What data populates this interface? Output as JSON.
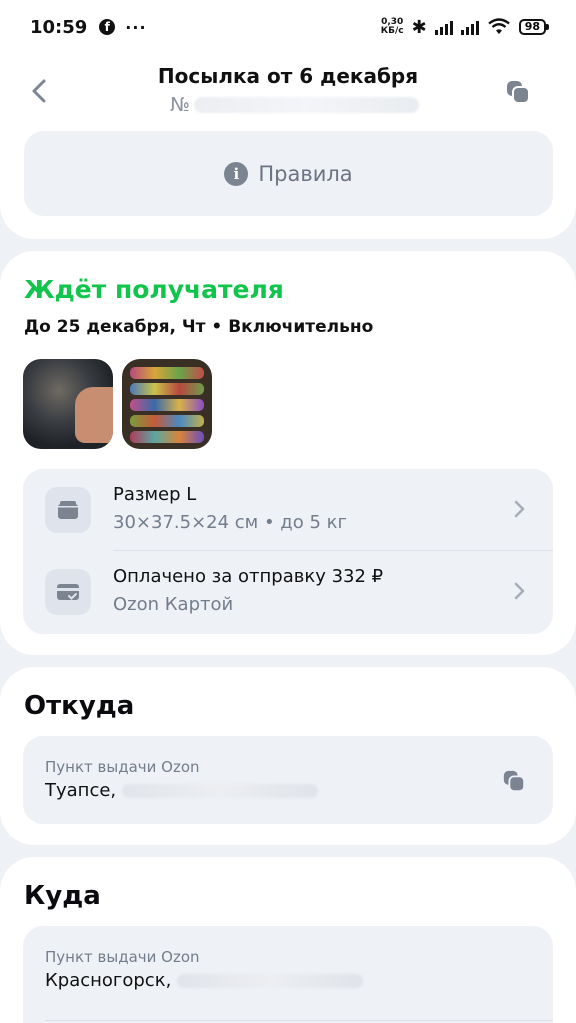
{
  "status_bar": {
    "time": "10:59",
    "social_icon": "facebook-icon",
    "more": "···",
    "net_speed_value": "0,30",
    "net_speed_unit": "КБ/с",
    "battery": "98"
  },
  "header": {
    "title": "Посылка от 6 декабря",
    "number_prefix": "№",
    "back_icon": "chevron-left-icon",
    "copy_icon": "copy-icon"
  },
  "rules": {
    "label": "Правила",
    "icon": "info-icon"
  },
  "status": {
    "title": "Ждёт получателя",
    "deadline": "До 25 декабря, Чт • Включительно",
    "accent_color": "#10c44c"
  },
  "details": [
    {
      "title": "Размер L",
      "subtitle": "30×37.5×24 см • до 5 кг",
      "icon": "box-icon"
    },
    {
      "title": "Оплачено за отправку 332 ₽",
      "subtitle": "Ozon Картой",
      "icon": "card-icon"
    }
  ],
  "from": {
    "heading": "Откуда",
    "label": "Пункт выдачи Ozon",
    "city": "Туапсе,"
  },
  "to": {
    "heading": "Куда",
    "label": "Пункт выдачи Ozon",
    "city": "Красногорск,"
  }
}
